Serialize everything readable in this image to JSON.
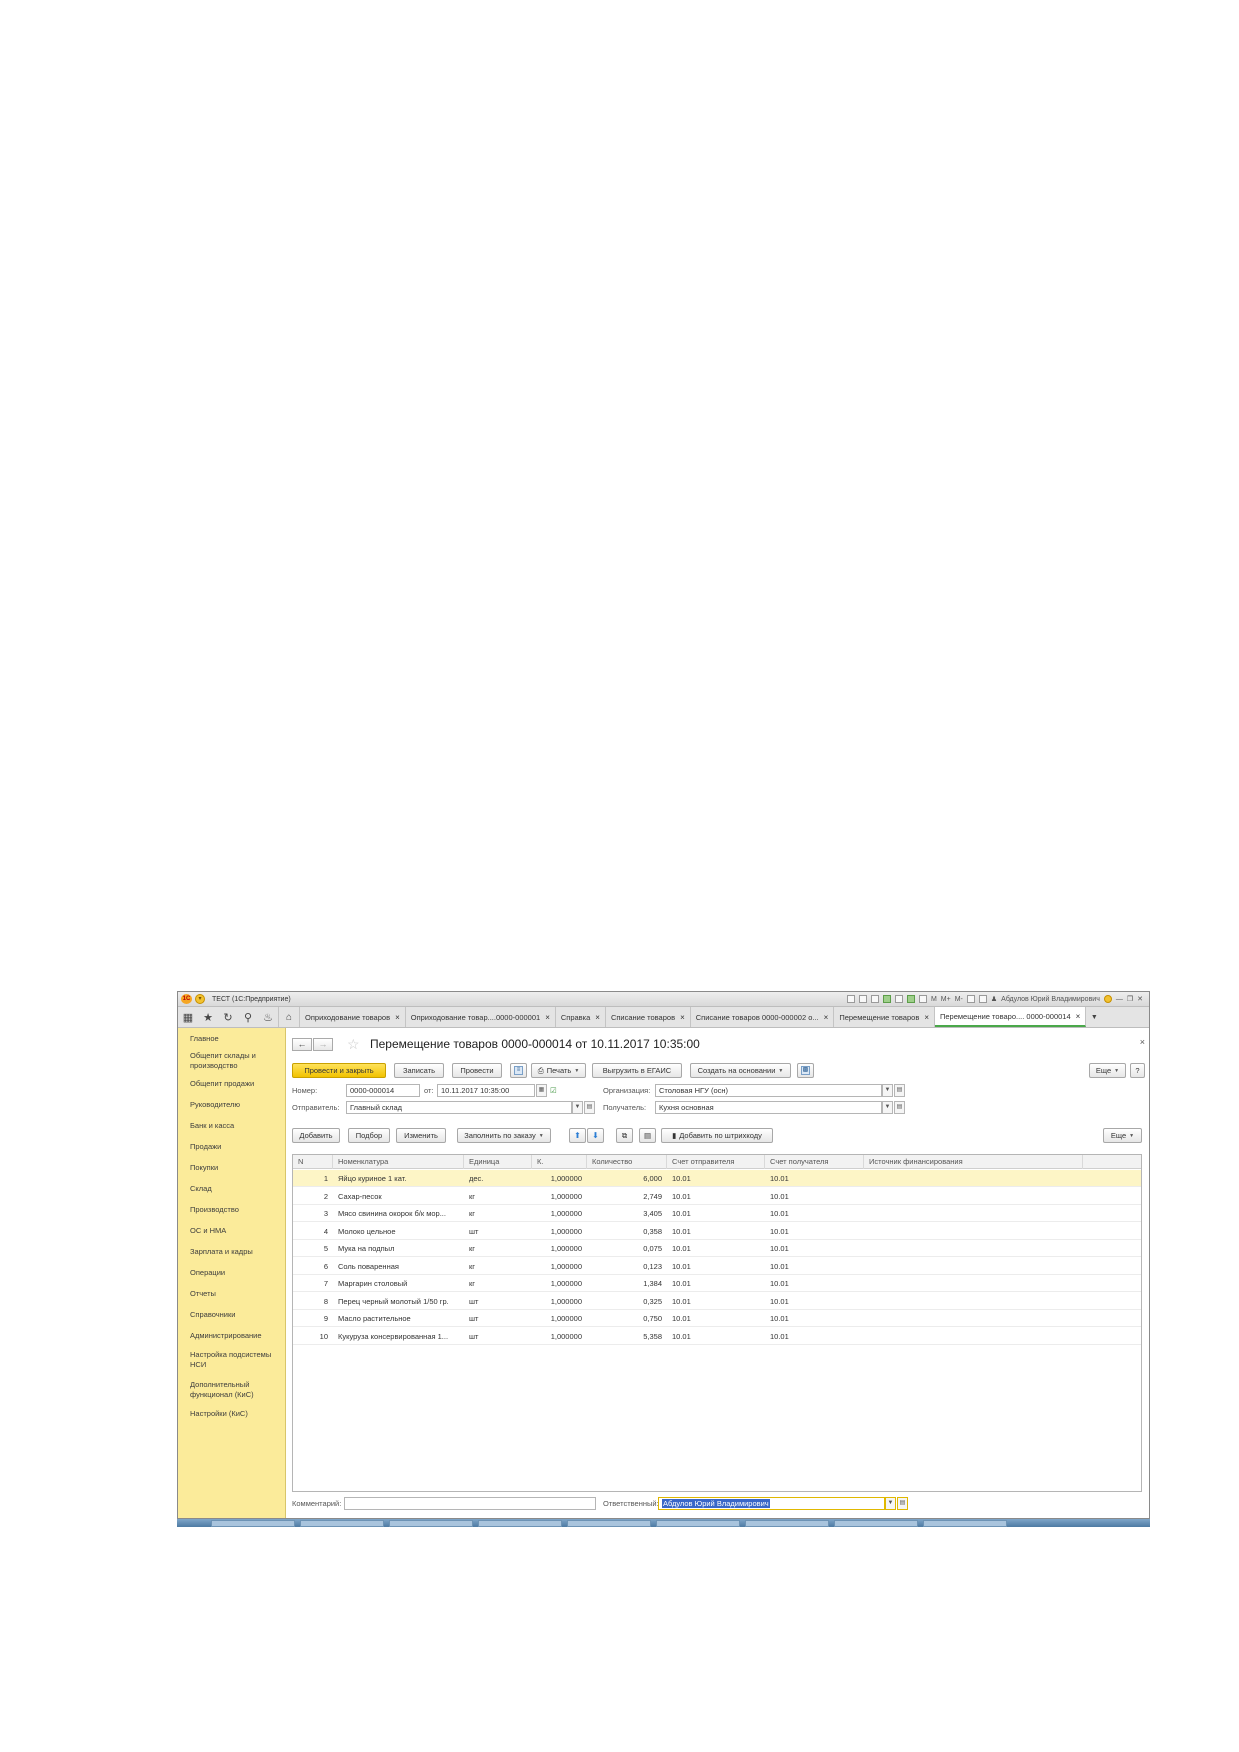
{
  "window": {
    "app_icon": "1C",
    "title": "ТЕСТ  (1С:Предприятие)",
    "user": "Абдулов Юрий Владимирович",
    "memory_buttons": [
      "M",
      "M+",
      "M-"
    ]
  },
  "tabs": [
    {
      "label": "Оприходование товаров"
    },
    {
      "label": "Оприходование товар....0000-000001"
    },
    {
      "label": "Справка"
    },
    {
      "label": "Списание товаров"
    },
    {
      "label": "Списание товаров 0000-000002 о..."
    },
    {
      "label": "Перемещение товаров"
    },
    {
      "label": "Перемещение товаро.... 0000-000014",
      "active": true
    }
  ],
  "sidebar": {
    "items": [
      {
        "label": "Главное"
      },
      {
        "label": "Общепит склады и производство"
      },
      {
        "label": "Общепит продажи"
      },
      {
        "label": "Руководителю"
      },
      {
        "label": "Банк и касса"
      },
      {
        "label": "Продажи"
      },
      {
        "label": "Покупки"
      },
      {
        "label": "Склад"
      },
      {
        "label": "Производство"
      },
      {
        "label": "ОС и НМА"
      },
      {
        "label": "Зарплата и кадры"
      },
      {
        "label": "Операции"
      },
      {
        "label": "Отчеты"
      },
      {
        "label": "Справочники"
      },
      {
        "label": "Администрирование"
      },
      {
        "label": "Настройка подсистемы НСИ"
      },
      {
        "label": "Дополнительный функционал (КиС)"
      },
      {
        "label": "Настройки (КиС)"
      }
    ]
  },
  "document": {
    "title": "Перемещение товаров 0000-000014 от 10.11.2017 10:35:00",
    "toolbar": {
      "post_close": "Провести и закрыть",
      "save": "Записать",
      "post": "Провести",
      "print": "Печать",
      "egais": "Выгрузить в ЕГАИС",
      "create_based": "Создать на основании",
      "more": "Еще",
      "help": "?"
    },
    "fields": {
      "number_label": "Номер:",
      "number": "0000-000014",
      "date_label": "от:",
      "date": "10.11.2017 10:35:00",
      "org_label": "Организация:",
      "org": "Столовая НГУ (осн)",
      "sender_label": "Отправитель:",
      "sender": "Главный склад",
      "receiver_label": "Получатель:",
      "receiver": "Кухня основная"
    },
    "table_toolbar": {
      "add": "Добавить",
      "pick": "Подбор",
      "change": "Изменить",
      "fill": "Заполнить по заказу",
      "barcode": "Добавить по штрихкоду",
      "more": "Еще"
    },
    "columns": [
      "N",
      "Номенклатура",
      "Единица",
      "К.",
      "Количество",
      "Счет отправителя",
      "Счет получателя",
      "Источник финансирования"
    ],
    "rows": [
      {
        "n": "1",
        "name": "Яйцо куриное 1 кат.",
        "unit": "дес.",
        "k": "1,000000",
        "qty": "6,000",
        "acc_from": "10.01",
        "acc_to": "10.01",
        "source": ""
      },
      {
        "n": "2",
        "name": "Сахар-песок",
        "unit": "кг",
        "k": "1,000000",
        "qty": "2,749",
        "acc_from": "10.01",
        "acc_to": "10.01",
        "source": ""
      },
      {
        "n": "3",
        "name": "Мясо свинина окорок б/к мор...",
        "unit": "кг",
        "k": "1,000000",
        "qty": "3,405",
        "acc_from": "10.01",
        "acc_to": "10.01",
        "source": ""
      },
      {
        "n": "4",
        "name": "Молоко цельное",
        "unit": "шт",
        "k": "1,000000",
        "qty": "0,358",
        "acc_from": "10.01",
        "acc_to": "10.01",
        "source": ""
      },
      {
        "n": "5",
        "name": "Мука на подпыл",
        "unit": "кг",
        "k": "1,000000",
        "qty": "0,075",
        "acc_from": "10.01",
        "acc_to": "10.01",
        "source": ""
      },
      {
        "n": "6",
        "name": "Соль поваренная",
        "unit": "кг",
        "k": "1,000000",
        "qty": "0,123",
        "acc_from": "10.01",
        "acc_to": "10.01",
        "source": ""
      },
      {
        "n": "7",
        "name": "Маргарин столовый",
        "unit": "кг",
        "k": "1,000000",
        "qty": "1,384",
        "acc_from": "10.01",
        "acc_to": "10.01",
        "source": ""
      },
      {
        "n": "8",
        "name": "Перец черный молотый 1/50 гр.",
        "unit": "шт",
        "k": "1,000000",
        "qty": "0,325",
        "acc_from": "10.01",
        "acc_to": "10.01",
        "source": ""
      },
      {
        "n": "9",
        "name": "Масло растительное",
        "unit": "шт",
        "k": "1,000000",
        "qty": "0,750",
        "acc_from": "10.01",
        "acc_to": "10.01",
        "source": ""
      },
      {
        "n": "10",
        "name": "Кукуруза консервированная 1...",
        "unit": "шт",
        "k": "1,000000",
        "qty": "5,358",
        "acc_from": "10.01",
        "acc_to": "10.01",
        "source": ""
      }
    ],
    "selected_row": 0,
    "footer": {
      "comment_label": "Комментарий:",
      "comment": "",
      "responsible_label": "Ответственный:",
      "responsible": "Абдулов Юрий Владимирович"
    }
  },
  "colors": {
    "sidebar_bg": "#fbeb9a",
    "primary_button": "#f2c200",
    "selected_row": "#fdf5c6",
    "active_tab_underline": "#4aa84a"
  }
}
